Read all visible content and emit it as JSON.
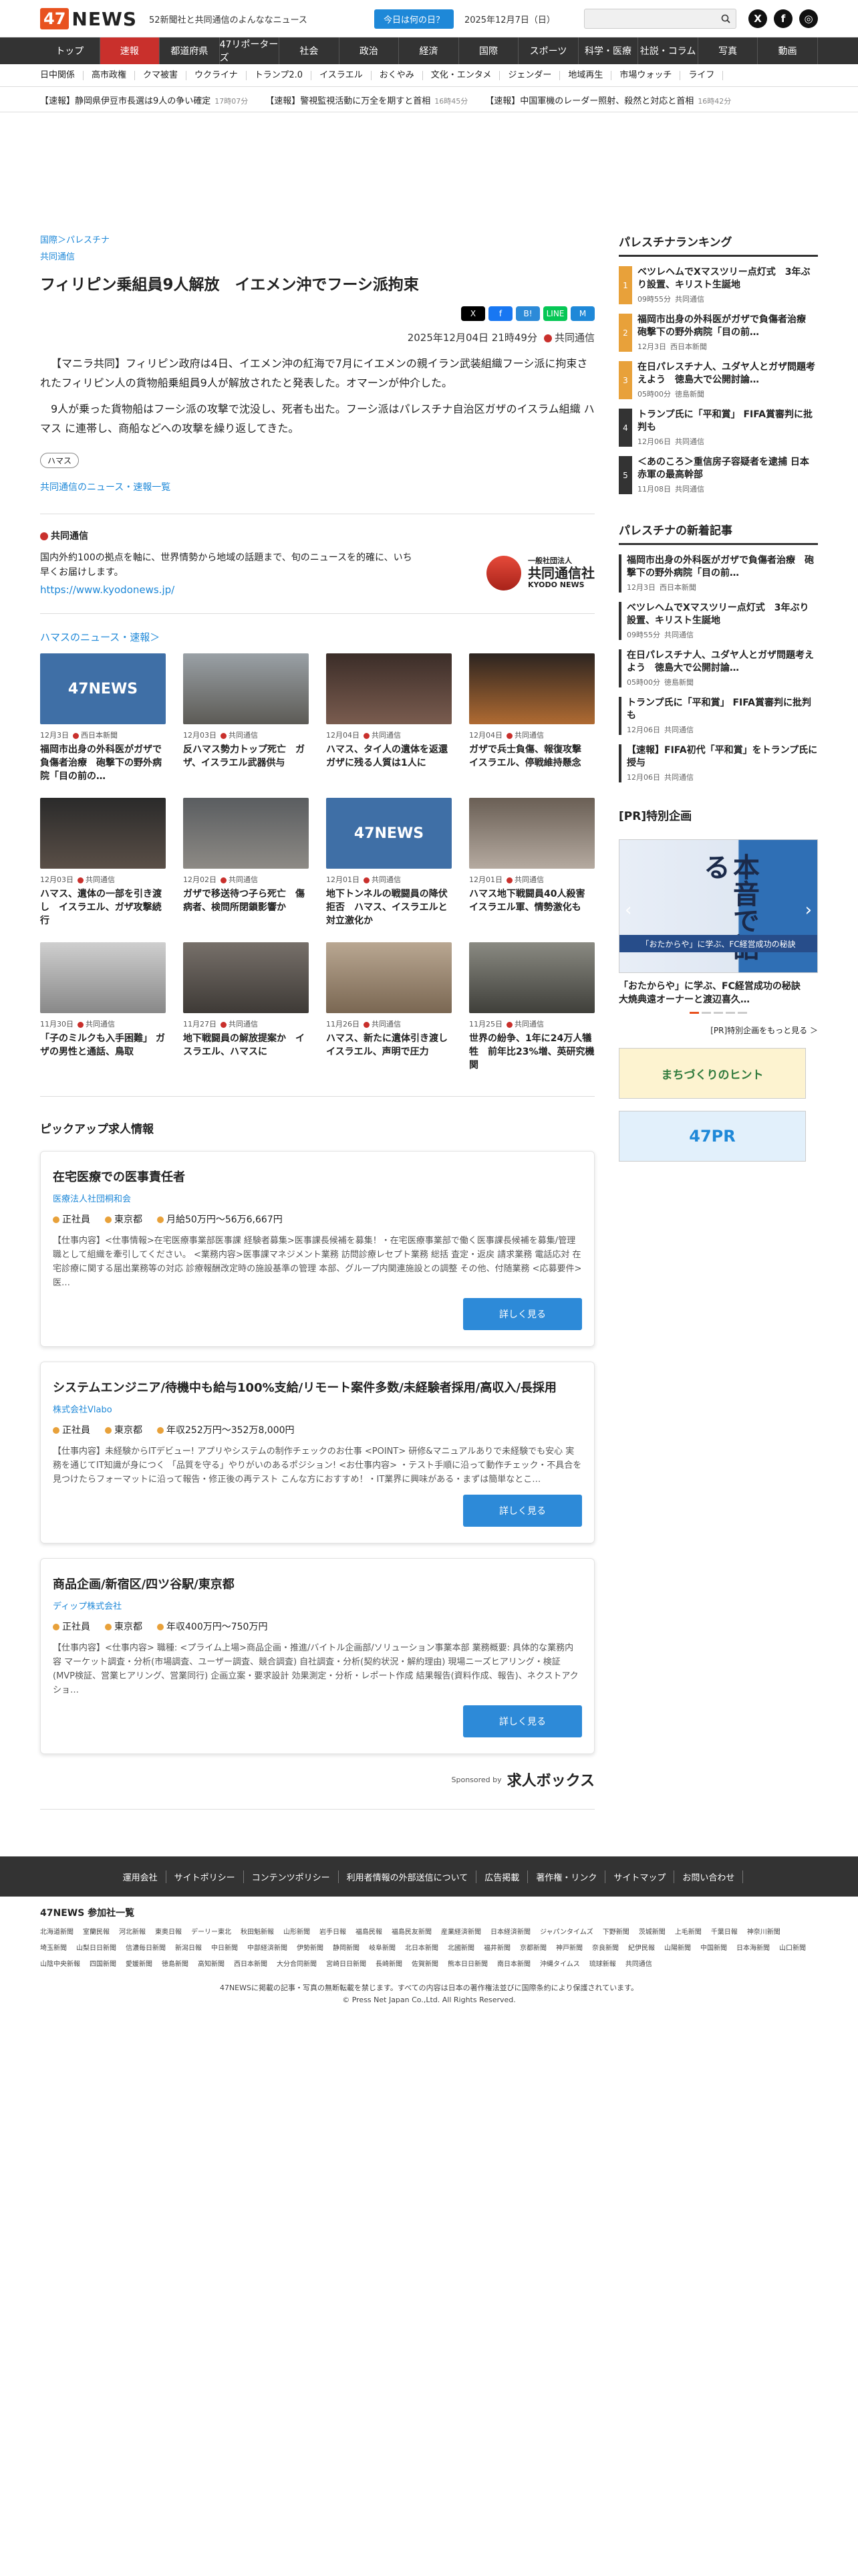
{
  "header": {
    "logo_num": "47",
    "logo_text": "NEWS",
    "tagline": "52新聞社と共同通信のよんななニュース",
    "today_button": "今日は何の日？",
    "date": "2025年12月7日（日）"
  },
  "nav": [
    "トップ",
    "速報",
    "都道府県",
    "47リポーターズ",
    "社会",
    "政治",
    "経済",
    "国際",
    "スポーツ",
    "科学・医療",
    "社説・コラム",
    "写真",
    "動画"
  ],
  "nav_active": 1,
  "subnav": [
    "日中関係",
    "高市政権",
    "クマ被害",
    "ウクライナ",
    "トランプ2.0",
    "イスラエル",
    "おくやみ",
    "文化・エンタメ",
    "ジェンダー",
    "地域再生",
    "市場ウォッチ",
    "ライフ"
  ],
  "ticker": [
    {
      "text": "【速報】静岡県伊豆市長選は9人の争い確定",
      "time": "17時07分"
    },
    {
      "text": "【速報】警視監視活動に万全を期すと首相",
      "time": "16時45分"
    },
    {
      "text": "【速報】中国軍機のレーダー照射、殺然と対応と首相",
      "time": "16時42分"
    }
  ],
  "article": {
    "crumb1": "国際＞パレスチナ",
    "crumb2": "共同通信",
    "title": "フィリピン乗組員9人解放　イエメン沖でフーシ派拘束",
    "datetime": "2025年12月04日 21時49分",
    "source": "共同通信",
    "share": [
      "X",
      "f",
      "B!",
      "LINE",
      "M"
    ],
    "para1": "【マニラ共同】フィリピン政府は4日、イエメン沖の紅海で7月にイエメンの親イラン武装組織フーシ派に拘束されたフィリピン人の貨物船乗組員9人が解放されたと発表した。オマーンが仲介した。",
    "para2": "9人が乗った貨物船はフーシ派の攻撃で沈没し、死者も出た。フーシ派はパレスチナ自治区ガザのイスラム組織 ハマス に連帯し、商船などへの攻撃を繰り返してきた。",
    "tag": "ハマス",
    "more": "共同通信のニュース・速報一覧"
  },
  "agency": {
    "name": "共同通信",
    "desc": "国内外約100の拠点を軸に、世界情勢から地域の話題まで、旬のニュースを的確に、いち早くお届けします。",
    "url": "https://www.kyodonews.jp/",
    "logo_small": "一般社団法人",
    "logo_big": "共同通信社",
    "logo_en": "KYODO NEWS"
  },
  "hamas_head": "ハマスのニュース・速報＞",
  "hamas_news": [
    {
      "date": "12月3日",
      "src": "西日本新聞",
      "title": "福岡市出身の外科医がガザで負傷者治療　砲撃下の野外病院「目の前の…",
      "style": "t47"
    },
    {
      "date": "12月03日",
      "src": "共同通信",
      "title": "反ハマス勢力トップ死亡　ガザ、イスラエル武器供与",
      "style": "p1"
    },
    {
      "date": "12月04日",
      "src": "共同通信",
      "title": "ハマス、タイ人の遺体を返還　ガザに残る人質は1人に",
      "style": "p2"
    },
    {
      "date": "12月04日",
      "src": "共同通信",
      "title": "ガザで兵士負傷、報復攻撃　イスラエル、停戦維持懸念",
      "style": "p3"
    },
    {
      "date": "12月03日",
      "src": "共同通信",
      "title": "ハマス、遺体の一部を引き渡し　イスラエル、ガザ攻撃続行",
      "style": "p4"
    },
    {
      "date": "12月02日",
      "src": "共同通信",
      "title": "ガザで移送待つ子ら死亡　傷病者、検問所閉鎖影響か",
      "style": "p5"
    },
    {
      "date": "12月01日",
      "src": "共同通信",
      "title": "地下トンネルの戦闘員の降伏拒否　ハマス、イスラエルと対立激化か",
      "style": "t47"
    },
    {
      "date": "12月01日",
      "src": "共同通信",
      "title": "ハマス地下戦闘員40人殺害　イスラエル軍、情勢激化も",
      "style": "p6"
    },
    {
      "date": "11月30日",
      "src": "共同通信",
      "title": "「子のミルクも入手困難」 ガザの男性と通話、鳥取",
      "style": "p7"
    },
    {
      "date": "11月27日",
      "src": "共同通信",
      "title": "地下戦闘員の解放提案か　イスラエル、ハマスに",
      "style": "p8"
    },
    {
      "date": "11月26日",
      "src": "共同通信",
      "title": "ハマス、新たに遺体引き渡し　イスラエル、声明で圧力",
      "style": "p9"
    },
    {
      "date": "11月25日",
      "src": "共同通信",
      "title": "世界の紛争、1年に24万人犠牲　前年比23%増、英研究機関",
      "style": "p10"
    }
  ],
  "jobs_head": "ピックアップ求人情報",
  "jobs": [
    {
      "title": "在宅医療での医事責任者",
      "company": "医療法人社団桐和会",
      "type": "正社員",
      "loc": "東京都",
      "pay": "月給50万円〜56万6,667円",
      "desc": "【仕事内容】<仕事情報>在宅医療事業部医事課 経験者募集>医事課長候補を募集！・在宅医療事業部で働く医事課長候補を募集/管理職として組織を牽引してください。 <業務内容>医事課マネジメント業務 訪問診療レセプト業務 総括 査定・返戻 請求業務 電話応対 在宅診療に関する届出業務等の対応 診療報酬改定時の施設基準の管理 本部、グループ内関連施設との調整 その他、付随業務 <応募要件> 医…",
      "btn": "詳しく見る"
    },
    {
      "title": "システムエンジニア/待機中も給与100%支給/リモート案件多数/未経験者採用/高収入/長採用",
      "company": "株式会社Vlabo",
      "type": "正社員",
      "loc": "東京都",
      "pay": "年収252万円〜352万8,000円",
      "desc": "【仕事内容】未経験からITデビュー! アプリやシステムの制作チェックのお仕事 <POINT> 研修&マニュアルありで未経験でも安心 実務を通じてIT知識が身につく 「品質を守る」やりがいのあるポジション! <お仕事内容> ・テスト手順に沿って動作チェック・不具合を見つけたらフォーマットに沿って報告・修正後の再テスト こんな方におすすめ！・IT業界に興味がある・まずは簡単なとこ…",
      "btn": "詳しく見る"
    },
    {
      "title": "商品企画/新宿区/四ツ谷駅/東京都",
      "company": "ディップ株式会社",
      "type": "正社員",
      "loc": "東京都",
      "pay": "年収400万円〜750万円",
      "desc": "【仕事内容】<仕事内容> 職種: <プライム上場>商品企画・推進/バイトル企画部/ソリューション事業本部 業務概要: 具体的な業務内容 マーケット調査・分析(市場調査、ユーザー調査、競合調査) 自社調査・分析(契約状況・解約理由) 現場ニーズヒアリング・検証(MVP検証、営業ヒアリング、営業同行) 企画立案・要求設計 効果測定・分析・レポート作成 結果報告(資料作成、報告)、ネクストアクショ…",
      "btn": "詳しく見る"
    }
  ],
  "sponsor": {
    "label": "Sponsored by",
    "brand": "求人ボックス"
  },
  "ranking": {
    "head": "パレスチナランキング",
    "items": [
      {
        "num": "1",
        "title": "ベツレヘムでXマスツリー点灯式　3年ぶり設置、キリスト生誕地",
        "time": "09時55分",
        "src": "共同通信"
      },
      {
        "num": "2",
        "title": "福岡市出身の外科医がガザで負傷者治療　砲撃下の野外病院「目の前…",
        "time": "12月3日",
        "src": "西日本新聞"
      },
      {
        "num": "3",
        "title": "在日パレスチナ人、ユダヤ人とガザ問題考えよう　徳島大で公開討論…",
        "time": "05時00分",
        "src": "徳島新聞"
      },
      {
        "num": "4",
        "title": "トランプ氏に「平和賞」 FIFA賞審判に批判も",
        "time": "12月06日",
        "src": "共同通信"
      },
      {
        "num": "5",
        "title": "＜あのころ＞重信房子容疑者を逮捕 日本赤軍の最高幹部",
        "time": "11月08日",
        "src": "共同通信"
      }
    ]
  },
  "newest": {
    "head": "パレスチナの新着記事",
    "items": [
      {
        "title": "福岡市出身の外科医がガザで負傷者治療　砲撃下の野外病院「目の前…",
        "time": "12月3日",
        "src": "西日本新聞"
      },
      {
        "title": "ベツレヘムでXマスツリー点灯式　3年ぶり設置、キリスト生誕地",
        "time": "09時55分",
        "src": "共同通信"
      },
      {
        "title": "在日パレスチナ人、ユダヤ人とガザ問題考えよう　徳島大で公開討論…",
        "time": "05時00分",
        "src": "徳島新聞"
      },
      {
        "title": "トランプ氏に「平和賞」 FIFA賞審判に批判も",
        "time": "12月06日",
        "src": "共同通信"
      },
      {
        "title": "【速報】FIFA初代「平和賞」をトランプ氏に授与",
        "time": "12月06日",
        "src": "共同通信"
      }
    ]
  },
  "pr": {
    "head": "[PR]特別企画",
    "big": "本音で語る",
    "bar": "「おたからや」に学ぶ、FC経営成功の秘訣",
    "title": "「おたからや」に学ぶ、FC経営成功の秘訣　大焼典遠オーナーと渡辺喜久…",
    "more": "[PR]特別企画をもっと見る ＞",
    "banner1": "まちづくりのヒント",
    "banner2": "47PR"
  },
  "footer": {
    "links": [
      "運用会社",
      "サイトポリシー",
      "コンテンツポリシー",
      "利用者情報の外部送信について",
      "広告掲載",
      "著作権・リンク",
      "サイトマップ",
      "お問い合わせ"
    ],
    "member_head": "47NEWS 参加社一覧",
    "members": [
      "北海道新聞",
      "室蘭民報",
      "河北新報",
      "東奥日報",
      "デーリー東北",
      "秋田魁新報",
      "山形新聞",
      "岩手日報",
      "福島民報",
      "福島民友新聞",
      "産業経済新聞",
      "日本経済新聞",
      "ジャパンタイムズ",
      "下野新聞",
      "茨城新聞",
      "上毛新聞",
      "千葉日報",
      "神奈川新聞",
      "埼玉新聞",
      "山梨日日新聞",
      "信濃毎日新聞",
      "新潟日報",
      "中日新聞",
      "中部経済新聞",
      "伊勢新聞",
      "静岡新聞",
      "岐阜新聞",
      "北日本新聞",
      "北國新聞",
      "福井新聞",
      "京都新聞",
      "神戸新聞",
      "奈良新聞",
      "紀伊民報",
      "山陽新聞",
      "中国新聞",
      "日本海新聞",
      "山口新聞",
      "山陰中央新報",
      "四国新聞",
      "愛媛新聞",
      "徳島新聞",
      "高知新聞",
      "西日本新聞",
      "大分合同新聞",
      "宮崎日日新聞",
      "長崎新聞",
      "佐賀新聞",
      "熊本日日新聞",
      "南日本新聞",
      "沖縄タイムス",
      "琉球新報",
      "共同通信"
    ],
    "copy1": "47NEWSに掲載の記事・写真の無断転載を禁じます。すべての内容は日本の著作権法並びに国際条約により保護されています。",
    "copy2": "© Press Net Japan Co.,Ltd. All Rights Reserved."
  }
}
